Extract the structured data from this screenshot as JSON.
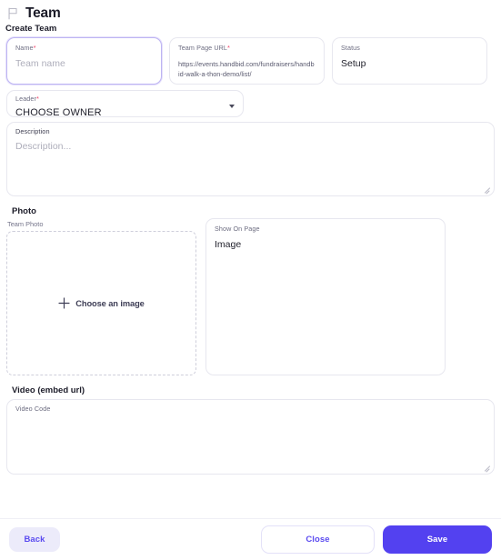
{
  "header": {
    "icon": "flag-icon",
    "title": "Team"
  },
  "form": {
    "section_title": "Create Team",
    "name": {
      "label": "Name",
      "required": "*",
      "placeholder": "Team name",
      "value": ""
    },
    "team_page_url": {
      "label": "Team Page URL",
      "required": "*",
      "value": "https://events.handbid.com/fundraisers/handbid-walk-a-thon-demo/list/"
    },
    "status": {
      "label": "Status",
      "value": "Setup"
    },
    "leader": {
      "label": "Leader",
      "required": "*",
      "value": "CHOOSE OWNER",
      "options": [
        "CHOOSE OWNER"
      ]
    },
    "description": {
      "label": "Description",
      "placeholder": "Description...",
      "value": ""
    }
  },
  "photo": {
    "section_title": "Photo",
    "team_photo_label": "Team Photo",
    "dropzone_text": "Choose an image",
    "show_on_page": {
      "label": "Show On Page",
      "value": "Image"
    }
  },
  "video": {
    "section_title": "Video (embed url)",
    "video_code": {
      "label": "Video Code",
      "value": ""
    }
  },
  "footer": {
    "back_label": "Back",
    "close_label": "Close",
    "save_label": "Save"
  },
  "colors": {
    "accent": "#5341f0",
    "accent_soft": "#ecebfa",
    "required_marker": "#f0456a",
    "border": "#e7e7ef",
    "focus_border": "#bdb4f2"
  }
}
